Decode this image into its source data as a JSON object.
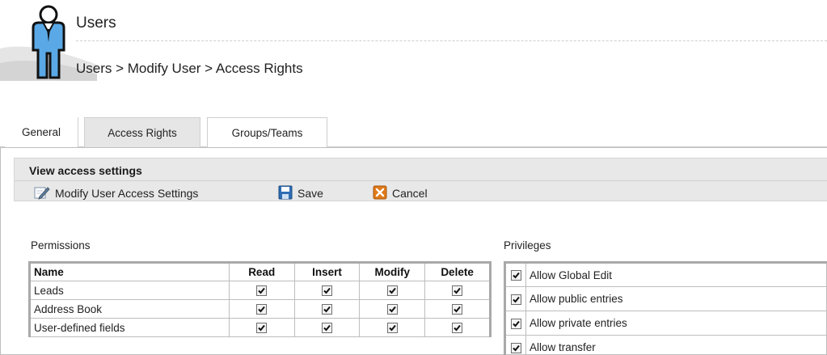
{
  "header": {
    "title": "Users",
    "breadcrumb": "Users > Modify User > Access Rights"
  },
  "tabs": [
    {
      "label": "General",
      "active": false
    },
    {
      "label": "Access Rights",
      "active": true
    },
    {
      "label": "Groups/Teams",
      "active": false
    }
  ],
  "panel": {
    "title": "View access settings",
    "toolbar": {
      "modify_label": "Modify User Access Settings",
      "save_label": "Save",
      "cancel_label": "Cancel"
    }
  },
  "permissions": {
    "label": "Permissions",
    "columns": [
      "Name",
      "Read",
      "Insert",
      "Modify",
      "Delete"
    ],
    "rows": [
      {
        "name": "Leads",
        "read": true,
        "insert": true,
        "modify": true,
        "delete": true
      },
      {
        "name": "Address Book",
        "read": true,
        "insert": true,
        "modify": true,
        "delete": true
      },
      {
        "name": "User-defined fields",
        "read": true,
        "insert": true,
        "modify": true,
        "delete": true
      }
    ]
  },
  "privileges": {
    "label": "Privileges",
    "items": [
      {
        "label": "Allow Global Edit",
        "checked": true
      },
      {
        "label": "Allow public entries",
        "checked": true
      },
      {
        "label": "Allow private entries",
        "checked": true
      },
      {
        "label": "Allow transfer",
        "checked": true
      }
    ]
  },
  "colors": {
    "header_bg": "#e8e8e8",
    "active_tab_bg": "#e6e6e6",
    "table_border": "#a9a9a9",
    "save_icon": "#2f6db5",
    "cancel_icon": "#e07a1a"
  },
  "icons": {
    "header": "user-figure-icon",
    "modify": "edit-pencil-icon",
    "save": "floppy-disk-icon",
    "cancel": "cancel-x-icon",
    "checkbox": "checkmark-icon"
  }
}
